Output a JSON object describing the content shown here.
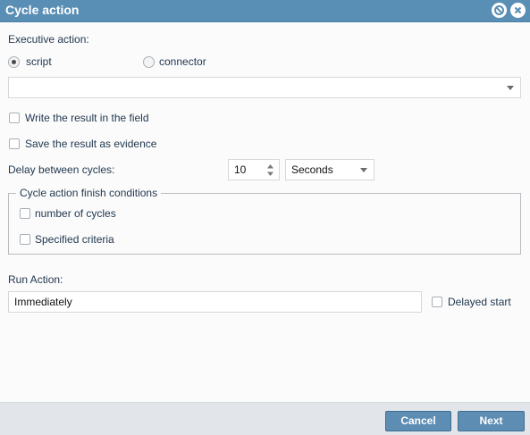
{
  "window": {
    "title": "Cycle action"
  },
  "titlebar_buttons": {
    "minimize_icon": "circle-slash-icon",
    "close_icon": "close-icon"
  },
  "executive_action": {
    "label": "Executive action:",
    "options": [
      {
        "label": "script",
        "checked": true
      },
      {
        "label": "connector",
        "checked": false
      }
    ],
    "select_value": ""
  },
  "write_result": {
    "label": "Write the result in the field",
    "checked": false
  },
  "save_evidence": {
    "label": "Save the result as evidence",
    "checked": false
  },
  "delay": {
    "label": "Delay between cycles:",
    "value": "10",
    "unit": "Seconds"
  },
  "finish_conditions": {
    "legend": "Cycle action finish conditions",
    "items": [
      {
        "label": "number of cycles",
        "checked": false
      },
      {
        "label": "Specified criteria",
        "checked": false
      }
    ]
  },
  "run_action": {
    "label": "Run Action:",
    "value": "Immediately",
    "delayed_label": "Delayed start",
    "delayed_checked": false
  },
  "footer": {
    "cancel_label": "Cancel",
    "next_label": "Next"
  },
  "colors": {
    "titlebar": "#5a8fb5",
    "button": "#5d8db3",
    "footer": "#e2e6ea"
  }
}
